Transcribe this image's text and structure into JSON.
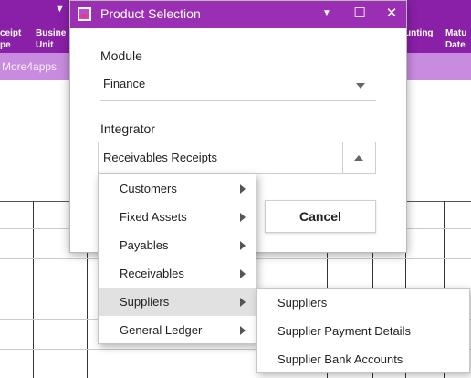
{
  "background": {
    "columns": [
      {
        "line1": "ceipt",
        "line2": "pe"
      },
      {
        "line1": "Busine",
        "line2": "Unit"
      },
      {
        "line1": "unting",
        "line2": ""
      },
      {
        "line1": "Matu",
        "line2": "Date"
      }
    ],
    "brand": "More4apps"
  },
  "dialog": {
    "title": "Product Selection",
    "minimize": "▼",
    "maximize": "☐",
    "close": "✕",
    "module_label": "Module",
    "module_value": "Finance",
    "integrator_label": "Integrator",
    "integrator_value": "Receivables Receipts",
    "cancel_label": "Cancel"
  },
  "menu": {
    "items": [
      {
        "label": "Customers"
      },
      {
        "label": "Fixed Assets"
      },
      {
        "label": "Payables"
      },
      {
        "label": "Receivables"
      },
      {
        "label": "Suppliers"
      },
      {
        "label": "General Ledger"
      }
    ],
    "active_index": 4
  },
  "submenu": {
    "items": [
      {
        "label": "Suppliers"
      },
      {
        "label": "Supplier Payment Details"
      },
      {
        "label": "Supplier Bank Accounts"
      }
    ]
  },
  "colors": {
    "accent": "#9b2fb4",
    "brand_bar": "#c98be0",
    "hover": "#e1e1e1"
  }
}
